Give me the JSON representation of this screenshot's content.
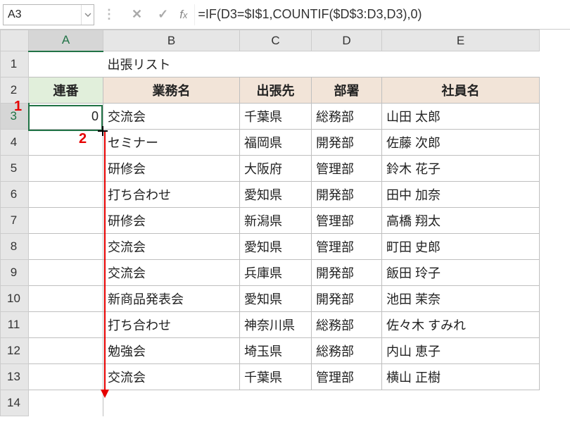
{
  "name_box": "A3",
  "formula": "=IF(D3=$I$1,COUNTIF($D$3:D3,D3),0)",
  "columns": [
    "A",
    "B",
    "C",
    "D",
    "E"
  ],
  "rows": [
    "1",
    "2",
    "3",
    "4",
    "5",
    "6",
    "7",
    "8",
    "9",
    "10",
    "11",
    "12",
    "13",
    "14"
  ],
  "active_col": "A",
  "active_row": "3",
  "title_cell": "出張リスト",
  "headers": {
    "A": "連番",
    "B": "業務名",
    "C": "出張先",
    "D": "部署",
    "E": "社員名"
  },
  "selected_value": "0",
  "data": [
    {
      "B": "交流会",
      "C": "千葉県",
      "D": "総務部",
      "E": "山田 太郎"
    },
    {
      "B": "セミナー",
      "C": "福岡県",
      "D": "開発部",
      "E": "佐藤 次郎"
    },
    {
      "B": "研修会",
      "C": "大阪府",
      "D": "管理部",
      "E": "鈴木 花子"
    },
    {
      "B": "打ち合わせ",
      "C": "愛知県",
      "D": "開発部",
      "E": "田中 加奈"
    },
    {
      "B": "研修会",
      "C": "新潟県",
      "D": "管理部",
      "E": "高橋 翔太"
    },
    {
      "B": "交流会",
      "C": "愛知県",
      "D": "管理部",
      "E": "町田 史郎"
    },
    {
      "B": "交流会",
      "C": "兵庫県",
      "D": "開発部",
      "E": "飯田 玲子"
    },
    {
      "B": "新商品発表会",
      "C": "愛知県",
      "D": "開発部",
      "E": "池田 茉奈"
    },
    {
      "B": "打ち合わせ",
      "C": "神奈川県",
      "D": "総務部",
      "E": "佐々木 すみれ"
    },
    {
      "B": "勉強会",
      "C": "埼玉県",
      "D": "総務部",
      "E": "内山 恵子"
    },
    {
      "B": "交流会",
      "C": "千葉県",
      "D": "管理部",
      "E": "横山 正樹"
    }
  ],
  "annotations": {
    "label1": "1",
    "label2": "2"
  },
  "chart_data": {
    "type": "table",
    "title": "出張リスト",
    "columns": [
      "連番",
      "業務名",
      "出張先",
      "部署",
      "社員名"
    ],
    "rows": [
      [
        0,
        "交流会",
        "千葉県",
        "総務部",
        "山田 太郎"
      ],
      [
        null,
        "セミナー",
        "福岡県",
        "開発部",
        "佐藤 次郎"
      ],
      [
        null,
        "研修会",
        "大阪府",
        "管理部",
        "鈴木 花子"
      ],
      [
        null,
        "打ち合わせ",
        "愛知県",
        "開発部",
        "田中 加奈"
      ],
      [
        null,
        "研修会",
        "新潟県",
        "管理部",
        "高橋 翔太"
      ],
      [
        null,
        "交流会",
        "愛知県",
        "管理部",
        "町田 史郎"
      ],
      [
        null,
        "交流会",
        "兵庫県",
        "開発部",
        "飯田 玲子"
      ],
      [
        null,
        "新商品発表会",
        "愛知県",
        "開発部",
        "池田 茉奈"
      ],
      [
        null,
        "打ち合わせ",
        "神奈川県",
        "総務部",
        "佐々木 すみれ"
      ],
      [
        null,
        "勉強会",
        "埼玉県",
        "総務部",
        "内山 恵子"
      ],
      [
        null,
        "交流会",
        "千葉県",
        "管理部",
        "横山 正樹"
      ]
    ]
  }
}
